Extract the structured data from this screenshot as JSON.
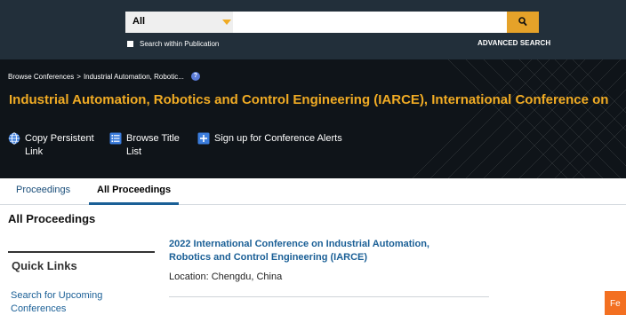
{
  "search": {
    "scope_selected": "All",
    "input_value": "",
    "input_placeholder": "",
    "within_publication_label": "Search within Publication",
    "advanced_label": "ADVANCED SEARCH",
    "button_icon": "search-icon"
  },
  "breadcrumb": {
    "root": "Browse Conferences",
    "separator": ">",
    "current": "Industrial Automation, Robotic...",
    "help_icon": "help-icon"
  },
  "header": {
    "title": "Industrial Automation, Robotics and Control Engineering (IARCE), International Conference on",
    "actions": [
      {
        "icon": "globe-icon",
        "line1": "Copy Persistent",
        "line2": "Link"
      },
      {
        "icon": "list-icon",
        "line1": "Browse Title",
        "line2": "List"
      },
      {
        "icon": "plus-square-icon",
        "line1": "Sign up for Conference Alerts",
        "line2": ""
      }
    ]
  },
  "tabs": {
    "proceedings": "Proceedings",
    "all_proceedings": "All Proceedings",
    "active": "All Proceedings"
  },
  "main": {
    "heading": "All Proceedings",
    "results": [
      {
        "title_line1": "2022 International Conference on Industrial Automation,",
        "title_line2": "Robotics and Control Engineering (IARCE)",
        "location": "Location: Chengdu, China"
      }
    ]
  },
  "sidebar": {
    "quick_links_title": "Quick Links",
    "links": [
      {
        "line1": "Search for Upcoming",
        "line2": "Conferences"
      }
    ]
  },
  "feedback": {
    "label": "Fe"
  },
  "colors": {
    "topbar_bg": "#222f3a",
    "header_bg": "#0f1419",
    "title_accent": "#f0ab24",
    "search_button": "#e5a229",
    "link_blue": "#1a5f96",
    "feedback_orange": "#f37021"
  }
}
